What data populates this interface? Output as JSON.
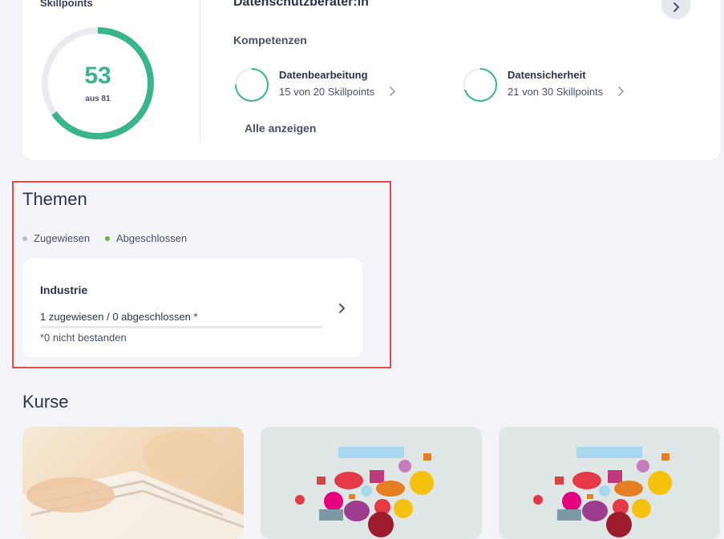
{
  "skillpoints": {
    "label": "Skillpoints",
    "value": "53",
    "total_label": "aus 81",
    "progress": 0.654
  },
  "role": {
    "title": "Datenschutzberater:in"
  },
  "competencies": {
    "label": "Kompetenzen",
    "items": [
      {
        "name": "Datenbearbeitung",
        "points": "15 von 20 Skillpoints",
        "progress": 0.75
      },
      {
        "name": "Datensicherheit",
        "points": "21 von 30 Skillpoints",
        "progress": 0.7
      }
    ],
    "show_all": "Alle anzeigen"
  },
  "themen": {
    "title": "Themen",
    "legend": [
      {
        "label": "Zugewiesen",
        "color": "#b8bcc8"
      },
      {
        "label": "Abgeschlossen",
        "color": "#6ab04c"
      }
    ],
    "topic": {
      "name": "Industrie",
      "status": "1 zugewiesen / 0 abgeschlossen *",
      "progress": 0,
      "failed_note": "*0 nicht bestanden"
    }
  },
  "kurse": {
    "title": "Kurse"
  },
  "colors": {
    "accent": "#3ab589",
    "highlight_border": "#e34a4a",
    "card": "#ffffff",
    "background": "#f3f4f7"
  },
  "icons": {
    "next": "chevron-right-icon",
    "competency_arrow": "chevron-right-icon",
    "topic_arrow": "chevron-right-icon"
  }
}
